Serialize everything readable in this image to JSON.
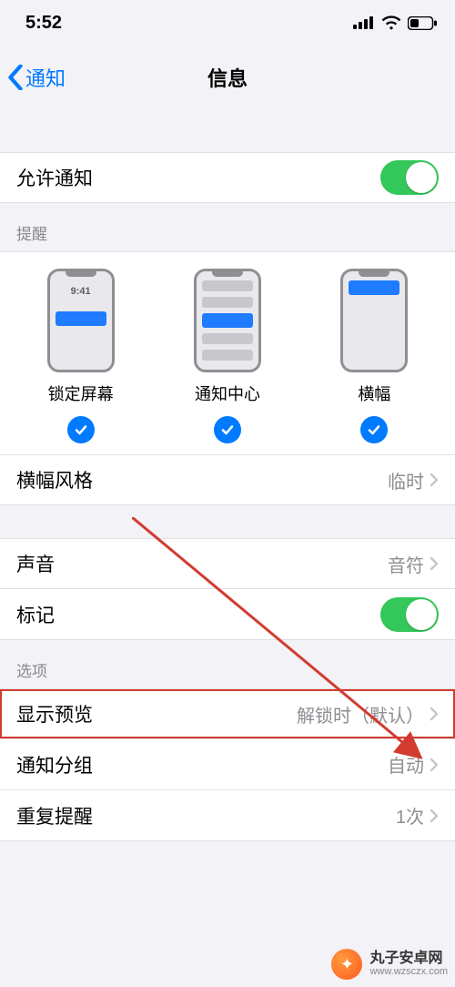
{
  "status_bar": {
    "time": "5:52"
  },
  "nav": {
    "back_label": "通知",
    "title": "信息"
  },
  "allow_notifications": {
    "label": "允许通知",
    "on": true
  },
  "alerts_section": {
    "header": "提醒",
    "lock_screen": {
      "label": "锁定屏幕",
      "preview_time": "9:41",
      "checked": true
    },
    "notification_center": {
      "label": "通知中心",
      "checked": true
    },
    "banners": {
      "label": "横幅",
      "checked": true
    }
  },
  "banner_style": {
    "label": "横幅风格",
    "value": "临时"
  },
  "sound": {
    "label": "声音",
    "value": "音符"
  },
  "badges": {
    "label": "标记",
    "on": true
  },
  "options_section": {
    "header": "选项",
    "show_previews": {
      "label": "显示预览",
      "value": "解锁时（默认）"
    },
    "grouping": {
      "label": "通知分组",
      "value": "自动"
    },
    "repeat": {
      "label": "重复提醒",
      "value": "1次"
    }
  },
  "watermark": {
    "line1": "丸子安卓网",
    "line2": "www.wzsczx.com"
  }
}
